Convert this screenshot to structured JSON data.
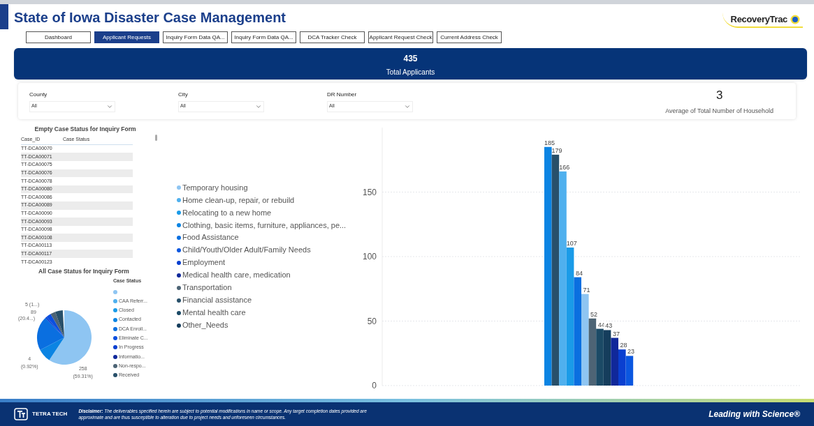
{
  "header": {
    "title": "State of Iowa Disaster Case Management",
    "logo_text": "RecoveryTrac"
  },
  "tabs": [
    {
      "label": "Dashboard",
      "selected": false
    },
    {
      "label": "Applicant Requests",
      "selected": true
    },
    {
      "label": "Inquiry Form Data QA...",
      "selected": false
    },
    {
      "label": "Inquiry Form Data QA...",
      "selected": false
    },
    {
      "label": "DCA Tracker Check",
      "selected": false
    },
    {
      "label": "Applicant Request Check",
      "selected": false
    },
    {
      "label": "Current Address Check",
      "selected": false
    }
  ],
  "banner": {
    "value": "435",
    "label": "Total Applicants"
  },
  "filters": [
    {
      "label": "County",
      "value": "All"
    },
    {
      "label": "City",
      "value": "All"
    },
    {
      "label": "DR Number",
      "value": "All"
    }
  ],
  "household_card": {
    "value": "3",
    "label": "Average of Total Number of Household"
  },
  "empty_case_table": {
    "title": "Empty Case Status for Inquiry Form",
    "columns": [
      "Case_ID",
      "Case Status"
    ],
    "rows": [
      "TT-DCA00070",
      "TT-DCA00071",
      "TT-DCA00075",
      "TT-DCA00076",
      "TT-DCA00078",
      "TT-DCA00080",
      "TT-DCA00086",
      "TT-DCA00089",
      "TT-DCA00090",
      "TT-DCA00093",
      "TT-DCA00098",
      "TT-DCA00108",
      "TT-DCA00113",
      "TT-DCA00117",
      "TT-DCA00123"
    ]
  },
  "pie": {
    "title": "All Case Status for Inquiry Form",
    "legend_title": "Case Status",
    "legend": [
      {
        "color": "#8ec5f2"
      },
      {
        "label": "CAA Referr...",
        "color": "#4fb0ee"
      },
      {
        "label": "Closed",
        "color": "#1a9be8"
      },
      {
        "label": "Contacted",
        "color": "#0b84e3"
      },
      {
        "label": "DCA Enroll...",
        "color": "#0a6fe0"
      },
      {
        "label": "Eliminate C...",
        "color": "#0b4fe0"
      },
      {
        "label": "In Progress",
        "color": "#0a3fd0"
      },
      {
        "label": "Informatio...",
        "color": "#10289a"
      },
      {
        "label": "Non-respo...",
        "color": "#4d6475"
      },
      {
        "label": "Received",
        "color": "#28506a"
      }
    ],
    "data_labels": [
      {
        "value": "5 (1...)"
      },
      {
        "value": "89",
        "detail": "(20.4...)"
      },
      {
        "value": "4",
        "detail": "(0.92%)"
      },
      {
        "value": "258",
        "detail": "(59.31%)"
      }
    ]
  },
  "needs_chart": {
    "chart_data": {
      "type": "bar",
      "grid": true,
      "ylim": [
        0,
        200
      ],
      "yticks": [
        0,
        50,
        100,
        150
      ],
      "data_labels": true,
      "series": [
        {
          "name": "Temporary housing",
          "color": "#8ec5f2",
          "values": [
            71
          ]
        },
        {
          "name": "Home clean-up, repair, or rebuild",
          "color": "#4fb0ee",
          "values": [
            166
          ]
        },
        {
          "name": "Relocating to a new home",
          "color": "#1a9be8",
          "values": [
            107
          ]
        },
        {
          "name": "Clothing, basic items, furniture, appliances, pe...",
          "color": "#0b84e3",
          "values": [
            185
          ]
        },
        {
          "name": "Food Assistance",
          "color": "#0a6fe0",
          "values": [
            84
          ]
        },
        {
          "name": "Child/Youth/Older Adult/Family Needs",
          "color": "#0b57e0",
          "values": [
            23
          ]
        },
        {
          "name": "Employment",
          "color": "#0a3fd0",
          "values": [
            28
          ]
        },
        {
          "name": "Medical health care, medication",
          "color": "#10289a",
          "values": [
            37
          ]
        },
        {
          "name": "Transportation",
          "color": "#4d6475",
          "values": [
            52
          ]
        },
        {
          "name": "Financial assistance",
          "color": "#28506a",
          "values": [
            179
          ]
        },
        {
          "name": "Mental health care",
          "color": "#1b4a66",
          "values": [
            44
          ]
        },
        {
          "name": "Other_Needs",
          "color": "#153d5c",
          "values": [
            43
          ]
        }
      ]
    }
  },
  "footer": {
    "company": "TETRA TECH",
    "disclaimer": "**Disclaimer:** The deliverables specified herein are subject to potential modifications in name or scope. Any target completion dates provided are approximate and are thus susceptible to alteration due to project needs and unforeseen circumstances.",
    "tagline": "Leading with Science®"
  }
}
